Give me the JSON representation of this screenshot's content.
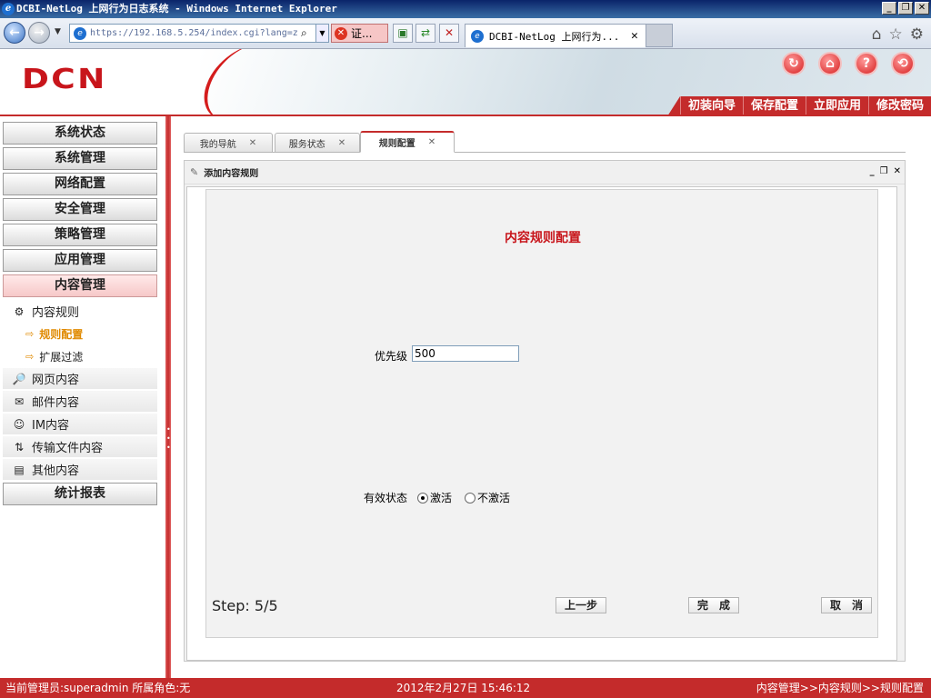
{
  "window": {
    "title": "DCBI-NetLog 上网行为日志系统 - Windows Internet Explorer"
  },
  "browser": {
    "url": "https://192.168.5.254/index.cgi?lang=z",
    "cert_label": "证...",
    "tab_title": "DCBI-NetLog 上网行为..."
  },
  "header": {
    "logo": "DCN",
    "menu": [
      "初装向导",
      "保存配置",
      "立即应用",
      "修改密码"
    ]
  },
  "sidebar": {
    "menu": [
      "系统状态",
      "系统管理",
      "网络配置",
      "安全管理",
      "策略管理",
      "应用管理",
      "内容管理"
    ],
    "content_items": {
      "rules": "内容规则",
      "rules_config": "规则配置",
      "ext_filter": "扩展过滤",
      "web": "网页内容",
      "mail": "邮件内容",
      "im": "IM内容",
      "file": "传输文件内容",
      "other": "其他内容"
    },
    "stats": "统计报表"
  },
  "tabs": [
    {
      "label": "我的导航"
    },
    {
      "label": "服务状态"
    },
    {
      "label": "规则配置"
    }
  ],
  "panel": {
    "title": "添加内容规则",
    "form_title": "内容规则配置",
    "priority_label": "优先级",
    "priority_value": "500",
    "state_label": "有效状态",
    "state_options": [
      "激活",
      "不激活"
    ],
    "state_selected": "激活",
    "step": "Step: 5/5",
    "btn_prev": "上一步",
    "btn_done": "完　成",
    "btn_cancel": "取　消"
  },
  "status": {
    "admin": "当前管理员:superadmin  所属角色:无",
    "datetime": "2012年2月27日 15:46:12",
    "breadcrumb": "内容管理>>内容规则>>规则配置"
  },
  "colors": {
    "brand_red": "#c42b2b",
    "highlight_orange": "#e08a00"
  }
}
